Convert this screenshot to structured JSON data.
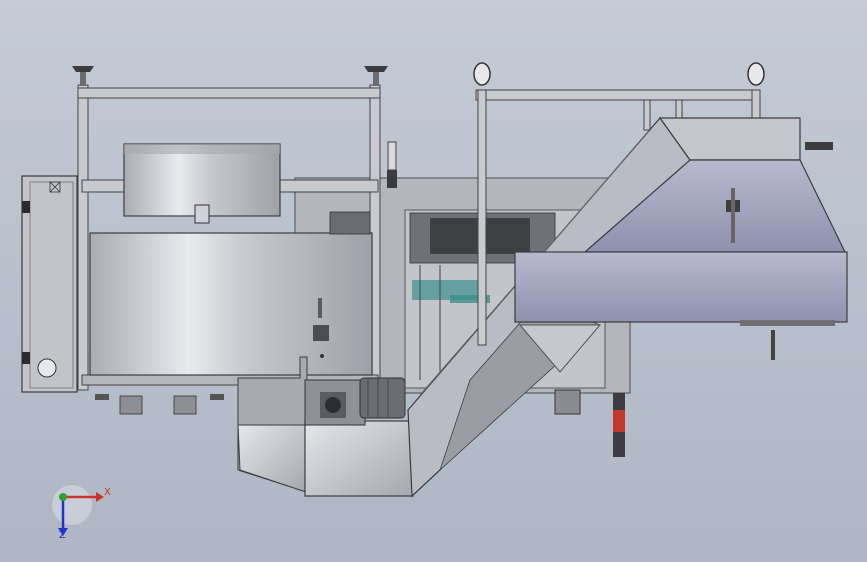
{
  "viewport": {
    "background_top": "#c4cbd6",
    "background_bottom": "#aeb6c4"
  },
  "triad": {
    "x_label": "X",
    "z_label": "Z",
    "x_color": "#d03030",
    "y_color": "#2ea02e",
    "z_color": "#2233cc"
  },
  "model": {
    "panel_color": "#b9bcc4",
    "steel_color": "#c8cad0",
    "dark_color": "#8a8c92",
    "hood_color": "#9ea0b8",
    "motor_color": "#6b6d73",
    "accent_teal": "#3f8f8c",
    "accent_red": "#c0392b"
  }
}
